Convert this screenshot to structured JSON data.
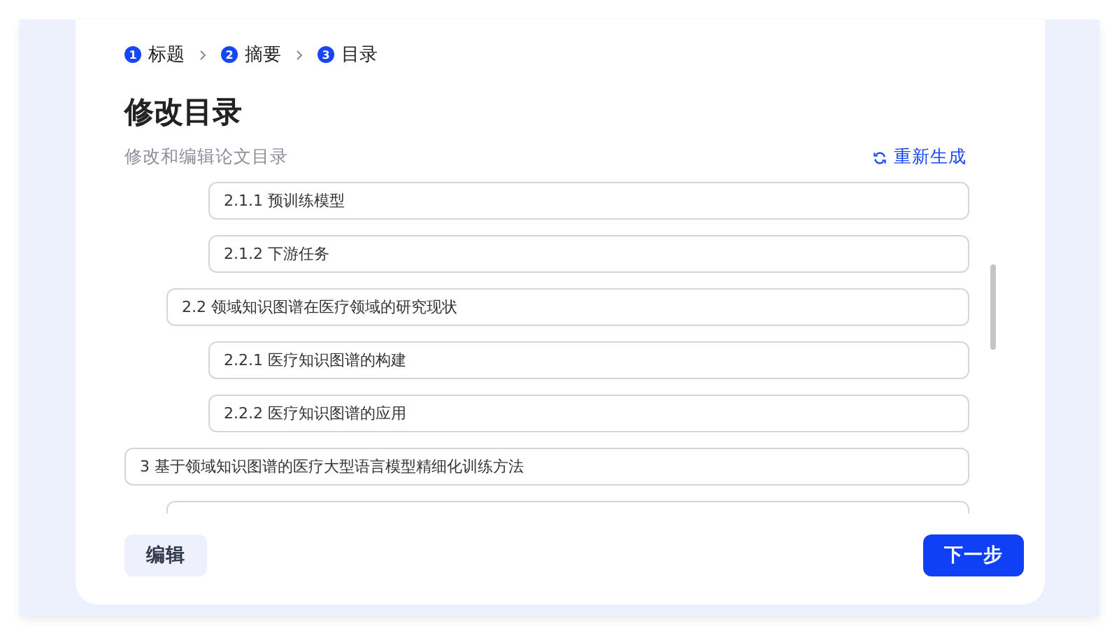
{
  "steps": [
    {
      "number": "1",
      "label": "标题"
    },
    {
      "number": "2",
      "label": "摘要"
    },
    {
      "number": "3",
      "label": "目录"
    }
  ],
  "title": "修改目录",
  "subtitle": "修改和编辑论文目录",
  "regenerate_link": "重新生成",
  "outline": [
    {
      "children": [
        {
          "children": [
            {
              "text": "2.1.1 预训练模型"
            },
            {
              "text": "2.1.2 下游任务"
            }
          ]
        },
        {
          "text": "2.2 领域知识图谱在医疗领域的研究现状",
          "children": [
            {
              "text": "2.2.1 医疗知识图谱的构建"
            },
            {
              "text": "2.2.2 医疗知识图谱的应用"
            }
          ]
        }
      ]
    },
    {
      "text": "3 基于领域知识图谱的医疗大型语言模型精细化训练方法"
    }
  ],
  "buttons": {
    "edit": "编辑",
    "next": "下一步"
  }
}
